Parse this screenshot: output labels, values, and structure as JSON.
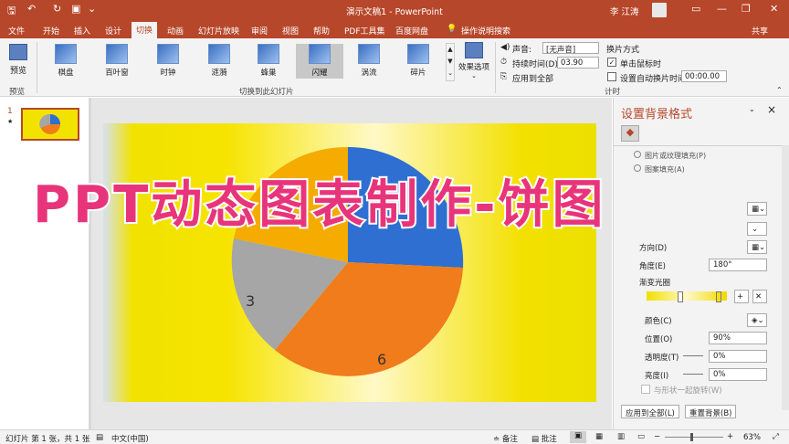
{
  "window": {
    "title": "演示文稿1  -  PowerPoint",
    "user": "李 江涛",
    "share": "共享"
  },
  "tabs": [
    "文件",
    "开始",
    "插入",
    "设计",
    "切换",
    "动画",
    "幻灯片放映",
    "审阅",
    "视图",
    "帮助",
    "PDF工具集",
    "百度网盘",
    "操作说明搜索"
  ],
  "active_tab": "切换",
  "ribbon": {
    "preview_label": "预览",
    "preview_group": "预览",
    "transitions": [
      "棋盘",
      "百叶窗",
      "时钟",
      "涟漪",
      "蜂巢",
      "闪耀",
      "涡流",
      "碎片"
    ],
    "selected_transition": "闪耀",
    "effect_options": "效果选项",
    "group_transitions": "切换到此幻灯片",
    "sound_label": "声音:",
    "sound_value": "[无声音]",
    "duration_label": "持续时间(D):",
    "duration_value": "03.90",
    "apply_all": "应用到全部",
    "advance_title": "换片方式",
    "on_click": "单击鼠标时",
    "after_time": "设置自动换片时间:",
    "after_value": "00:00.00",
    "timing_group": "计时"
  },
  "thumb": {
    "number": "1",
    "star": "★"
  },
  "pie_labels": {
    "gray": "3",
    "orange": "6"
  },
  "banner": "PPT动态图表制作-饼图",
  "panel": {
    "title": "设置背景格式",
    "close": "×",
    "row_partial1": "图片或纹理填充(P)",
    "row_partial2": "图案填充(A)",
    "direction": "方向(D)",
    "angle_label": "角度(E)",
    "angle_value": "180°",
    "gradient_stops": "渐变光圈",
    "color_label": "颜色(C)",
    "position_label": "位置(O)",
    "position_value": "90%",
    "transparency_label": "透明度(T)",
    "transparency_value": "0%",
    "brightness_label": "亮度(I)",
    "brightness_value": "0%",
    "rotate_with_shape": "与形状一起旋转(W)",
    "apply_all": "应用到全部(L)",
    "reset": "重置背景(B)"
  },
  "status": {
    "slide_info": "幻灯片 第 1 张，共 1 张",
    "language": "中文(中国)",
    "notes": "备注",
    "comments": "批注",
    "zoom": "63%"
  },
  "colors": {
    "accent": "#b7472a",
    "pie_blue": "#2e6fd1",
    "pie_orange": "#f07c1c",
    "pie_gray": "#a6a6a6",
    "pie_gold": "#f5ab00",
    "banner": "#e8347a"
  }
}
